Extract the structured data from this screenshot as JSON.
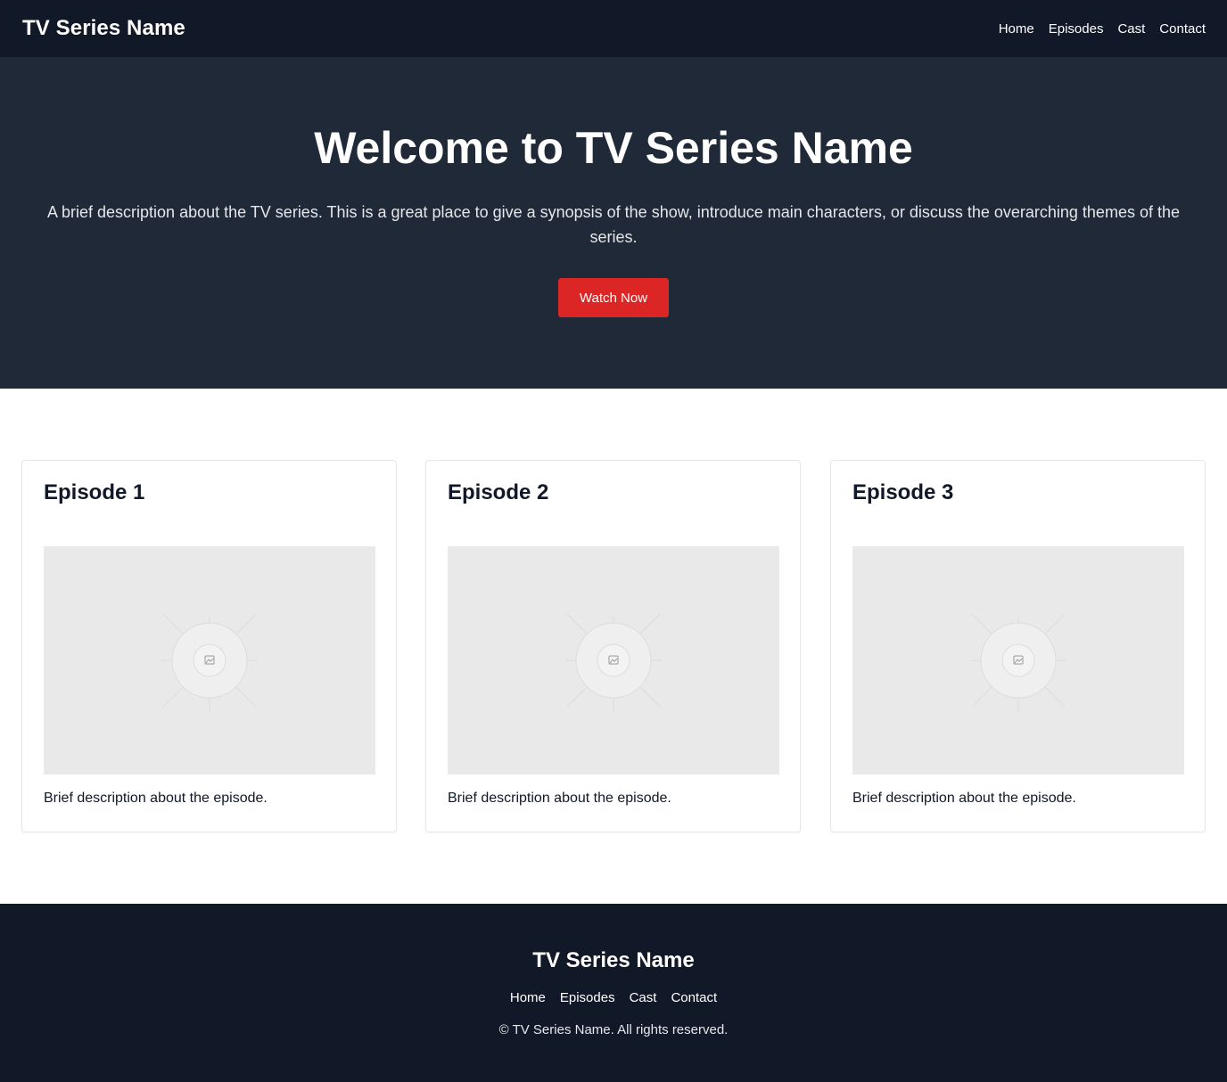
{
  "header": {
    "brand": "TV Series Name",
    "nav": [
      "Home",
      "Episodes",
      "Cast",
      "Contact"
    ]
  },
  "hero": {
    "title": "Welcome to TV Series Name",
    "description": "A brief description about the TV series. This is a great place to give a synopsis of the show, introduce main characters, or discuss the overarching themes of the series.",
    "cta": "Watch Now"
  },
  "episodes": [
    {
      "title": "Episode 1",
      "description": "Brief description about the episode.",
      "image_icon": "image-placeholder-icon"
    },
    {
      "title": "Episode 2",
      "description": "Brief description about the episode.",
      "image_icon": "image-placeholder-icon"
    },
    {
      "title": "Episode 3",
      "description": "Brief description about the episode.",
      "image_icon": "image-placeholder-icon"
    }
  ],
  "footer": {
    "brand": "TV Series Name",
    "nav": [
      "Home",
      "Episodes",
      "Cast",
      "Contact"
    ],
    "copyright": "© TV Series Name. All rights reserved."
  },
  "colors": {
    "nav_bg": "#111827",
    "hero_bg": "#1f2937",
    "accent": "#dc2626",
    "placeholder": "#e9e9e9"
  }
}
